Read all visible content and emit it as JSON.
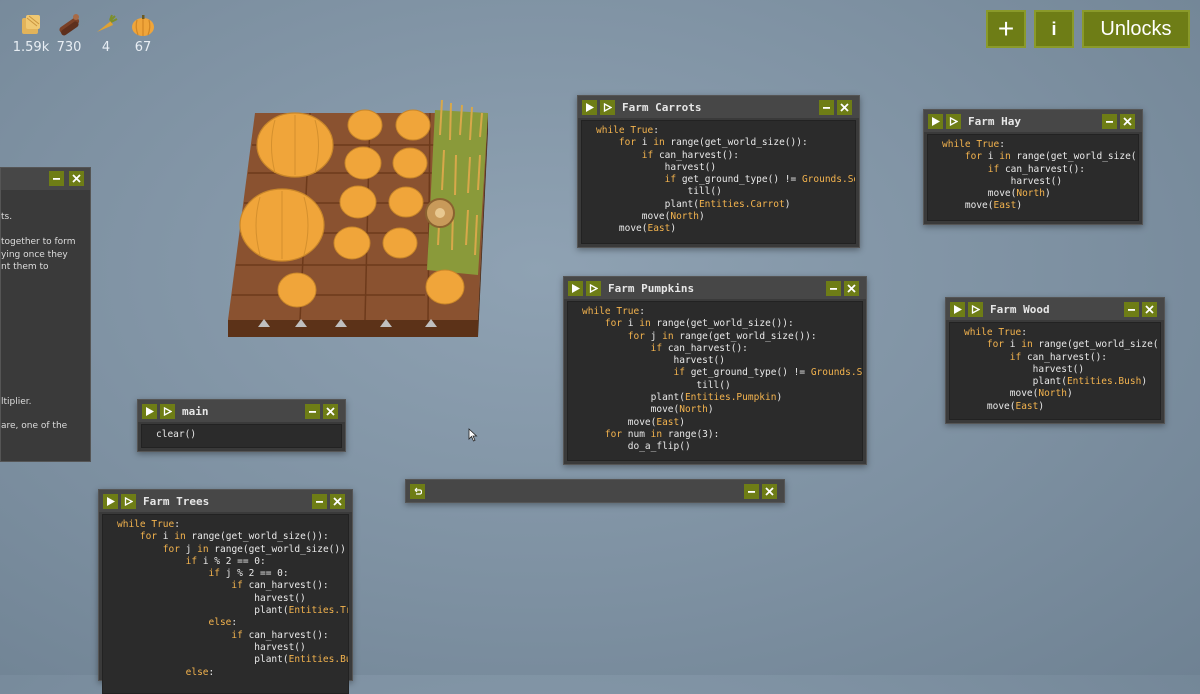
{
  "resources": [
    {
      "icon": "hay-icon",
      "value": "1.59k"
    },
    {
      "icon": "wood-icon",
      "value": "730"
    },
    {
      "icon": "carrot-icon",
      "value": "4"
    },
    {
      "icon": "pumpkin-icon",
      "value": "67"
    }
  ],
  "top_buttons": {
    "add": "+",
    "info": "i",
    "unlocks": "Unlocks"
  },
  "colors": {
    "button_green": "#6e7d16",
    "keyword": "#f3b34e",
    "window_bg": "#3a3a3a",
    "code_bg": "#2b2b2b",
    "background": "#8293a4"
  },
  "side_panel": {
    "lines": [
      "ts.",
      "together to form",
      "ying once they",
      "nt them to",
      "ltiplier.",
      "are, one of the"
    ]
  },
  "windows": {
    "farm_carrots": {
      "title": "Farm Carrots"
    },
    "farm_hay": {
      "title": "Farm Hay"
    },
    "farm_pumpkins": {
      "title": "Farm Pumpkins"
    },
    "farm_wood": {
      "title": "Farm Wood"
    },
    "main": {
      "title": "main"
    },
    "farm_trees": {
      "title": "Farm Trees"
    }
  }
}
